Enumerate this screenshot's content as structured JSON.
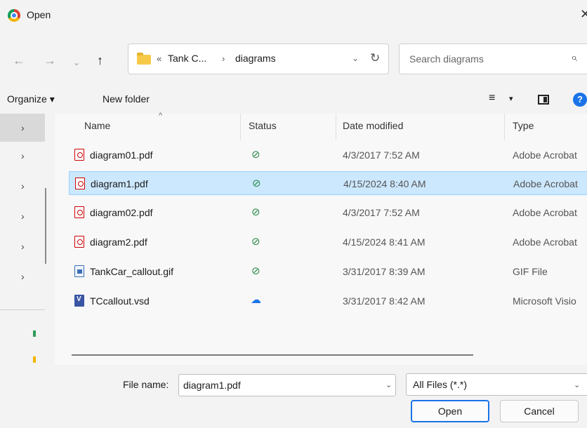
{
  "window": {
    "title": "Open",
    "close_glyph": "✕"
  },
  "nav": {
    "back": "←",
    "forward": "→",
    "recent": "⌄",
    "up": "↑"
  },
  "address": {
    "chevron": "«",
    "crumbs": [
      "Tank C...",
      "diagrams"
    ],
    "separator": "›",
    "dropdown": "⌄",
    "refresh": "↻"
  },
  "search": {
    "placeholder": "Search diagrams",
    "icon": "⌕"
  },
  "toolbar": {
    "organize_label": "Organize ▾",
    "new_folder_label": "New folder",
    "view_glyph": "≡",
    "view_caret": "▾",
    "help_glyph": "?"
  },
  "navpane": {
    "expand_glyph": "›"
  },
  "columns": {
    "name": "Name",
    "status": "Status",
    "date": "Date modified",
    "type": "Type",
    "sort_glyph": "^"
  },
  "files": [
    {
      "name": "diagram01.pdf",
      "status": "synced",
      "status_glyph": "⊘",
      "date": "4/3/2017 7:52 AM",
      "type": "Adobe Acrobat",
      "icon": "pdf-icon"
    },
    {
      "name": "diagram1.pdf",
      "status": "synced",
      "status_glyph": "⊘",
      "date": "4/15/2024 8:40 AM",
      "type": "Adobe Acrobat",
      "icon": "pdf-icon",
      "selected": true
    },
    {
      "name": "diagram02.pdf",
      "status": "synced",
      "status_glyph": "⊘",
      "date": "4/3/2017 7:52 AM",
      "type": "Adobe Acrobat",
      "icon": "pdf-icon"
    },
    {
      "name": "diagram2.pdf",
      "status": "synced",
      "status_glyph": "⊘",
      "date": "4/15/2024 8:41 AM",
      "type": "Adobe Acrobat",
      "icon": "pdf-icon"
    },
    {
      "name": "TankCar_callout.gif",
      "status": "synced",
      "status_glyph": "⊘",
      "date": "3/31/2017 8:39 AM",
      "type": "GIF File",
      "icon": "gif-icon"
    },
    {
      "name": "TCcallout.vsd",
      "status": "cloud",
      "status_glyph": "☁",
      "date": "3/31/2017 8:42 AM",
      "type": "Microsoft Visio",
      "icon": "vsd-icon"
    }
  ],
  "footer": {
    "file_name_label": "File name:",
    "file_name_value": "diagram1.pdf",
    "filter_label": "All Files (*.*)",
    "dropdown_glyph": "⌄",
    "open_label": "Open",
    "cancel_label": "Cancel"
  },
  "colors": {
    "accent": "#1a73e8",
    "selection": "#cce8ff",
    "synced": "#2a8a4a",
    "pdf": "#cc0000"
  }
}
